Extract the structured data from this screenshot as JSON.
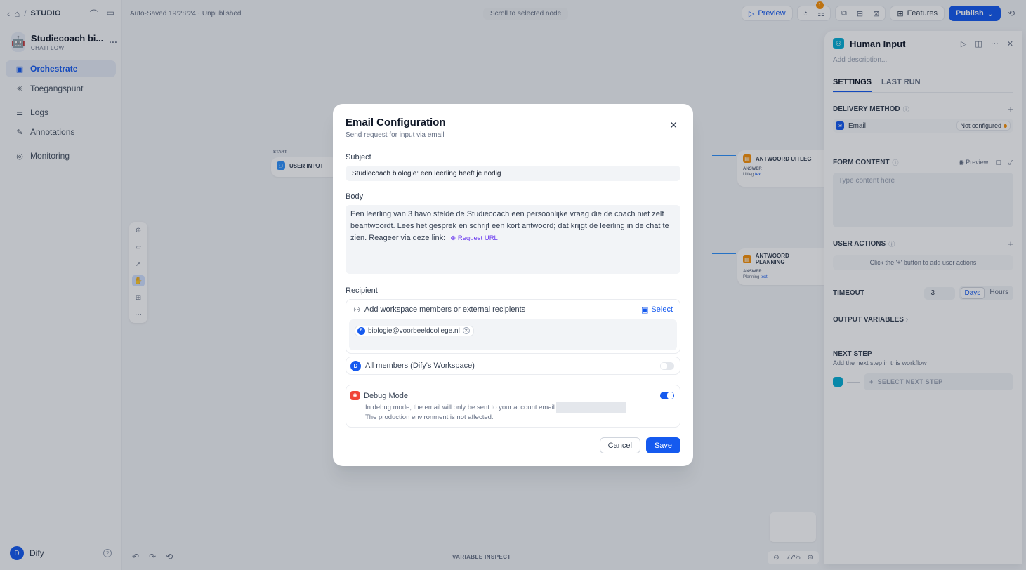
{
  "sidebar": {
    "breadcrumb": "STUDIO",
    "app_name": "Studiecoach bi...",
    "app_mode": "CHATFLOW",
    "nav": [
      {
        "label": "Orchestrate",
        "icon": "flow-icon"
      },
      {
        "label": "Toegangspunt",
        "icon": "access-point-icon"
      },
      {
        "label": "Logs",
        "icon": "logs-icon"
      },
      {
        "label": "Annotations",
        "icon": "annotation-icon"
      },
      {
        "label": "Monitoring",
        "icon": "monitoring-icon"
      }
    ],
    "user_initial": "D",
    "user_name": "Dify"
  },
  "canvas": {
    "autosave": "Auto-Saved 19:28:24 · Unpublished",
    "scroll_to_node": "Scroll to selected node",
    "start_label": "START",
    "start_node": "USER INPUT",
    "answer_nodes": [
      {
        "title": "ANTWOORD UITLEG",
        "sub": "ANSWER",
        "var_source": "Uitleg",
        "var_name": "text"
      },
      {
        "title": "ANTWOORD PLANNING",
        "sub": "ANSWER",
        "var_source": "Planning",
        "var_name": "text"
      }
    ],
    "zoom": "77%",
    "variable_inspect": "VARIABLE INSPECT"
  },
  "toolbar": {
    "preview": "Preview",
    "badge_count": "1",
    "features": "Features",
    "publish": "Publish"
  },
  "panel": {
    "title": "Human Input",
    "description_placeholder": "Add description...",
    "tabs": [
      "SETTINGS",
      "LAST RUN"
    ],
    "delivery_method": "DELIVERY METHOD",
    "delivery_email": "Email",
    "not_configured": "Not configured",
    "form_content": "FORM CONTENT",
    "form_preview": "Preview",
    "form_placeholder": "Type content here",
    "user_actions": "USER ACTIONS",
    "user_actions_empty": "Click the '+' button to add user actions",
    "timeout": "TIMEOUT",
    "timeout_value": "3",
    "timeout_units": [
      "Days",
      "Hours"
    ],
    "output_variables": "OUTPUT VARIABLES",
    "next_step": "NEXT STEP",
    "next_step_desc": "Add the next step in this workflow",
    "select_next_step": "SELECT NEXT STEP"
  },
  "modal": {
    "title": "Email Configuration",
    "subtitle": "Send request for input via email",
    "subject_label": "Subject",
    "subject_value": "Studiecoach biologie: een leerling heeft je nodig",
    "body_label": "Body",
    "body_text": "Een leerling van 3 havo stelde de Studiecoach een persoonlijke vraag die de coach niet zelf beantwoordt. Lees het gesprek en schrijf een kort antwoord; dat krijgt de leerling in de chat te zien. Reageer via deze link:",
    "body_link": "Request URL",
    "recipient_label": "Recipient",
    "recipient_placeholder": "Add workspace members or external recipients",
    "select_label": "Select",
    "recipient_chip_initial": "B",
    "recipient_email": "biologie@voorbeeldcollege.nl",
    "all_members_initial": "D",
    "all_members": "All members (Dify's Workspace)",
    "debug_title": "Debug Mode",
    "debug_line1": "In debug mode, the email will only be sent to your account email",
    "debug_line2": "The production environment is not affected.",
    "cancel": "Cancel",
    "save": "Save"
  }
}
